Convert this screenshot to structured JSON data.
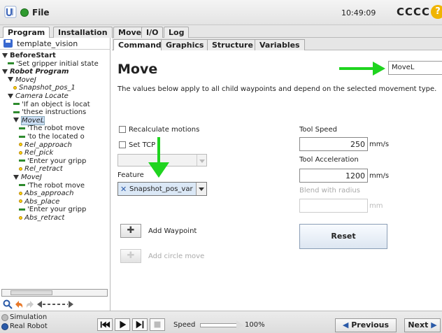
{
  "topbar": {
    "menu_label": "File",
    "time": "10:49:09",
    "robot_name": "CCCC",
    "help_glyph": "?"
  },
  "main_tabs": [
    "Program",
    "Installation",
    "Move",
    "I/O",
    "Log"
  ],
  "program": {
    "name": "template_vision"
  },
  "tree": [
    {
      "text": "BeforeStart",
      "style": "bold",
      "icon": "triangle",
      "indent": 0
    },
    {
      "text": "'Set gripper initial state",
      "style": "",
      "icon": "comment",
      "indent": 1
    },
    {
      "text": "Robot Program",
      "style": "bolditalic",
      "icon": "triangle",
      "indent": 0
    },
    {
      "text": "MoveJ",
      "style": "italic",
      "icon": "triangle",
      "indent": 1
    },
    {
      "text": "Snapshot_pos_1",
      "style": "italic",
      "icon": "point",
      "indent": 2
    },
    {
      "text": "Camera Locate",
      "style": "italic",
      "icon": "triangle",
      "indent": 1
    },
    {
      "text": "'If an object is locat",
      "style": "",
      "icon": "comment",
      "indent": 2
    },
    {
      "text": "'these instructions",
      "style": "",
      "icon": "comment",
      "indent": 2
    },
    {
      "text": "MoveL",
      "style": "italic",
      "icon": "triangle",
      "indent": 2,
      "selected": true
    },
    {
      "text": "'The robot move",
      "style": "",
      "icon": "comment",
      "indent": 3
    },
    {
      "text": "'to the located o",
      "style": "",
      "icon": "comment",
      "indent": 3
    },
    {
      "text": "Rel_approach",
      "style": "italic",
      "icon": "point",
      "indent": 3
    },
    {
      "text": "Rel_pick",
      "style": "italic",
      "icon": "point",
      "indent": 3
    },
    {
      "text": "'Enter your gripp",
      "style": "",
      "icon": "comment",
      "indent": 3
    },
    {
      "text": "Rel_retract",
      "style": "italic",
      "icon": "point",
      "indent": 3
    },
    {
      "text": "MoveJ",
      "style": "italic",
      "icon": "triangle",
      "indent": 2
    },
    {
      "text": "'The robot move",
      "style": "",
      "icon": "comment",
      "indent": 3
    },
    {
      "text": "Abs_approach",
      "style": "italic",
      "icon": "point",
      "indent": 3
    },
    {
      "text": "Abs_place",
      "style": "italic",
      "icon": "point",
      "indent": 3
    },
    {
      "text": "'Enter your gripp",
      "style": "",
      "icon": "comment",
      "indent": 3
    },
    {
      "text": "Abs_retract",
      "style": "italic",
      "icon": "point",
      "indent": 3
    }
  ],
  "sub_tabs": [
    "Command",
    "Graphics",
    "Structure",
    "Variables"
  ],
  "command": {
    "title": "Move",
    "move_type": "MoveL",
    "description": "The values below apply to all child waypoints and depend on the selected movement type.",
    "recalculate_label": "Recalculate motions",
    "set_tcp_label": "Set TCP",
    "feature_label": "Feature",
    "feature_value": "Snapshot_pos_var",
    "add_waypoint_label": "Add Waypoint",
    "add_circle_label": "Add circle move",
    "tool_speed_label": "Tool Speed",
    "tool_speed_value": "250",
    "tool_speed_unit": "mm/s",
    "tool_accel_label": "Tool Acceleration",
    "tool_accel_value": "1200",
    "tool_accel_unit": "mm/s",
    "blend_label": "Blend with radius",
    "blend_unit": "mm",
    "reset_label": "Reset"
  },
  "bottom": {
    "simulation_label": "Simulation",
    "real_robot_label": "Real Robot",
    "speed_label": "Speed",
    "speed_value": "100%",
    "speed_fraction": 1.0,
    "previous_label": "Previous",
    "next_label": "Next"
  },
  "colors": {
    "accent_blue": "#2a5aa8",
    "arrow_green": "#1fd41f",
    "file_green": "#2f9a2f"
  }
}
